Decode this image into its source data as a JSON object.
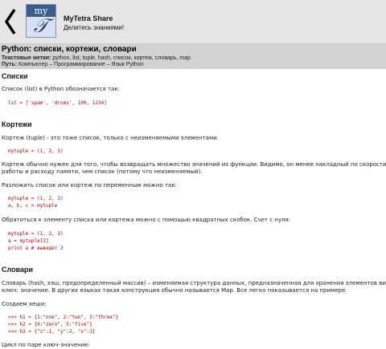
{
  "header": {
    "logo_text": "my",
    "logo_glyph": "𝒯",
    "title": "MyTetra Share",
    "subtitle": "Делитесь знаниями!"
  },
  "note": {
    "title": "Python: списки, кортежи, словари",
    "tags_label": "Текстовые метки:",
    "tags": "python, list, tuple, hash, список, кортеж, словарь, map",
    "path_label": "Путь:",
    "path": "Компьютер – Программирование – Язык Python"
  },
  "content": {
    "h_lists": "Списки",
    "p_lists": "Список (list) в Python обозначается так:",
    "code_list": "lst = ['spam', 'drums', 100, 1234]",
    "h_tuples": "Кортежи",
    "p_tuple1": "Кортеж (tuple) - это тоже список, только с неизменяемыми элементами.",
    "code_tuple1": "mytuple = (1, 2, 3)",
    "p_tuple2a": "Кортеж обычно нужен для того, чтобы возвращать множество значений из функции. Видимо, он менее накладный по скорости",
    "p_tuple2b": "работы и расходу памяти, чем список (потому что неизменяемый).",
    "p_unpack": "Разложить список или кортеж по переменным можно так:",
    "code_unpack1": "mytuple = (1, 2, 3)",
    "code_unpack2": "a, b, c = mytuple",
    "p_index": "Обратиться к элементу списка или кортежа можно с помощью квадратных скобок. Счет с нуля:",
    "code_index1": "mytuple = (1, 2, 3)",
    "code_index2": "a = mytuple[2]",
    "code_index3": "print a # выведет 3",
    "h_dicts": "Словари",
    "p_dict1": "Словарь (hash, хэш, предопределенный массив) – изменяемая структура данных, предназначенная для хранения элементов вида",
    "p_dict2": "ключ: значение. В других языках такая конструкция обычно называется Map. Все легко показывается на примере.",
    "p_create": "Создаем хеши:",
    "code_hash1": ">>> h1 = {1:\"one\", 2:\"two\", 3:\"three\"}",
    "code_hash2": ">>> h2 = {0:\"zero\", 5:\"five\"}",
    "code_hash3": ">>> h3 = {\"z\":1, \"y\":2, \"x\":3}",
    "p_loop": "Цикл по паре ключ-значение:"
  }
}
